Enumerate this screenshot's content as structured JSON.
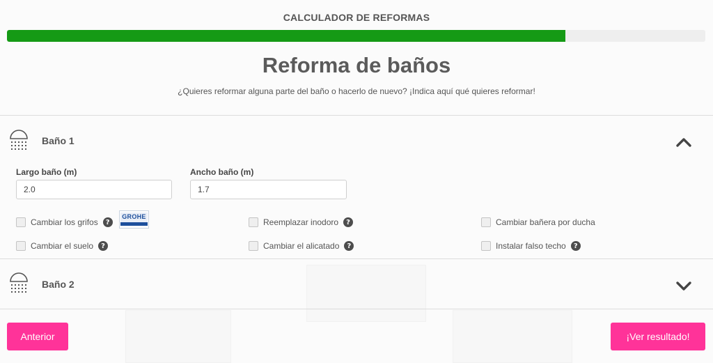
{
  "header": {
    "app_title": "CALCULADOR DE REFORMAS",
    "progress_percent": 80
  },
  "page": {
    "title": "Reforma de baños",
    "subtitle": "¿Quieres reformar alguna parte del baño o hacerlo de nuevo? ¡Indica aquí qué quieres reformar!"
  },
  "sections": [
    {
      "label": "Baño 1",
      "expanded": true,
      "fields": {
        "largo": {
          "label": "Largo baño (m)",
          "value": "2.0"
        },
        "ancho": {
          "label": "Ancho baño (m)",
          "value": "1.7"
        }
      },
      "options": [
        {
          "label": "Cambiar los grifos",
          "checked": false,
          "help": true,
          "brand": "GROHE"
        },
        {
          "label": "Reemplazar inodoro",
          "checked": false,
          "help": true
        },
        {
          "label": "Cambiar bañera por ducha",
          "checked": false,
          "help": false
        },
        {
          "label": "Cambiar el suelo",
          "checked": false,
          "help": true
        },
        {
          "label": "Cambiar el alicatado",
          "checked": false,
          "help": true
        },
        {
          "label": "Instalar falso techo",
          "checked": false,
          "help": true
        }
      ]
    },
    {
      "label": "Baño 2",
      "expanded": false
    }
  ],
  "footer": {
    "prev_label": "Anterior",
    "result_label": "¡Ver resultado!"
  },
  "icons": {
    "help_glyph": "?"
  },
  "colors": {
    "accent": "#ff3399",
    "progress": "#159a15",
    "progress_track": "#eeeeee"
  }
}
